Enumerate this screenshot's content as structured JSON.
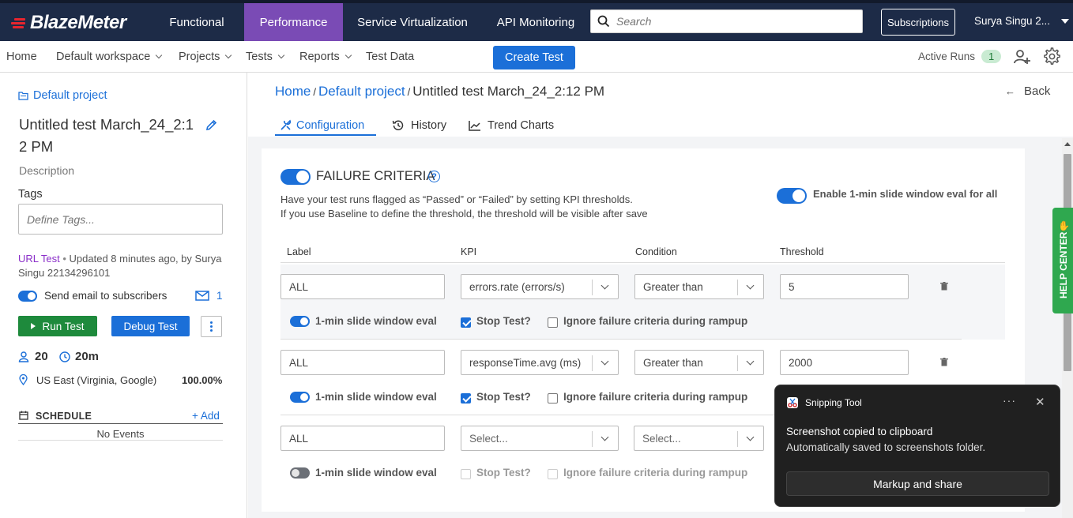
{
  "topbar": {
    "logo": "BlazeMeter",
    "nav": [
      "Functional",
      "Performance",
      "Service Virtualization",
      "API Monitoring"
    ],
    "search_placeholder": "Search",
    "subscriptions": "Subscriptions",
    "user": "Surya Singu 2..."
  },
  "subnav": {
    "items": [
      "Home",
      "Default workspace",
      "Projects",
      "Tests",
      "Reports",
      "Test Data"
    ],
    "create_test": "Create Test",
    "active_runs_label": "Active Runs",
    "active_runs_count": "1"
  },
  "sidebar": {
    "project_link": "Default project",
    "test_title": "Untitled test March_24_2:12 PM",
    "description": "Description",
    "tags_label": "Tags",
    "tags_placeholder": "Define Tags...",
    "test_type": "URL Test",
    "updated": "Updated 8 minutes ago, by Surya Singu 22134296101",
    "send_email": "Send email to subscribers",
    "subscribers_count": "1",
    "run_test": "Run Test",
    "debug_test": "Debug Test",
    "users": "20",
    "duration": "20m",
    "location": "US East (Virginia, Google)",
    "location_pct": "100.00%",
    "schedule_label": "SCHEDULE",
    "add_label": "Add",
    "no_events": "No Events"
  },
  "breadcrumb": {
    "home": "Home",
    "project": "Default project",
    "current": "Untitled test March_24_2:12 PM",
    "back": "Back"
  },
  "tabs": [
    "Configuration",
    "History",
    "Trend Charts"
  ],
  "failure_criteria": {
    "title": "FAILURE CRITERIA",
    "desc1": "Have your test runs flagged as “Passed” or “Failed” by setting KPI thresholds.",
    "desc2": "If you use Baseline to define the threshold, the threshold will be visible after save",
    "enable_all": "Enable 1-min slide window eval for all",
    "col_label": "Label",
    "col_kpi": "KPI",
    "col_condition": "Condition",
    "col_threshold": "Threshold",
    "slide_window": "1-min slide window eval",
    "stop_test": "Stop Test?",
    "ignore_rampup": "Ignore failure criteria during rampup",
    "rows": [
      {
        "label": "ALL",
        "kpi": "errors.rate (errors/s)",
        "condition": "Greater than",
        "threshold": "5"
      },
      {
        "label": "ALL",
        "kpi": "responseTime.avg (ms)",
        "condition": "Greater than",
        "threshold": "2000"
      },
      {
        "label": "ALL",
        "kpi": "Select...",
        "condition": "Select...",
        "threshold": ""
      }
    ]
  },
  "toast": {
    "app": "Snipping Tool",
    "title": "Screenshot copied to clipboard",
    "subtitle": "Automatically saved to screenshots folder.",
    "action": "Markup and share"
  },
  "help_center": "HELP CENTER",
  "colors": {
    "brand_blue": "#1b6fd8",
    "performance_tab": "#7a4bb5",
    "run_green": "#1e8a3c",
    "topbar": "#1d2b47"
  }
}
